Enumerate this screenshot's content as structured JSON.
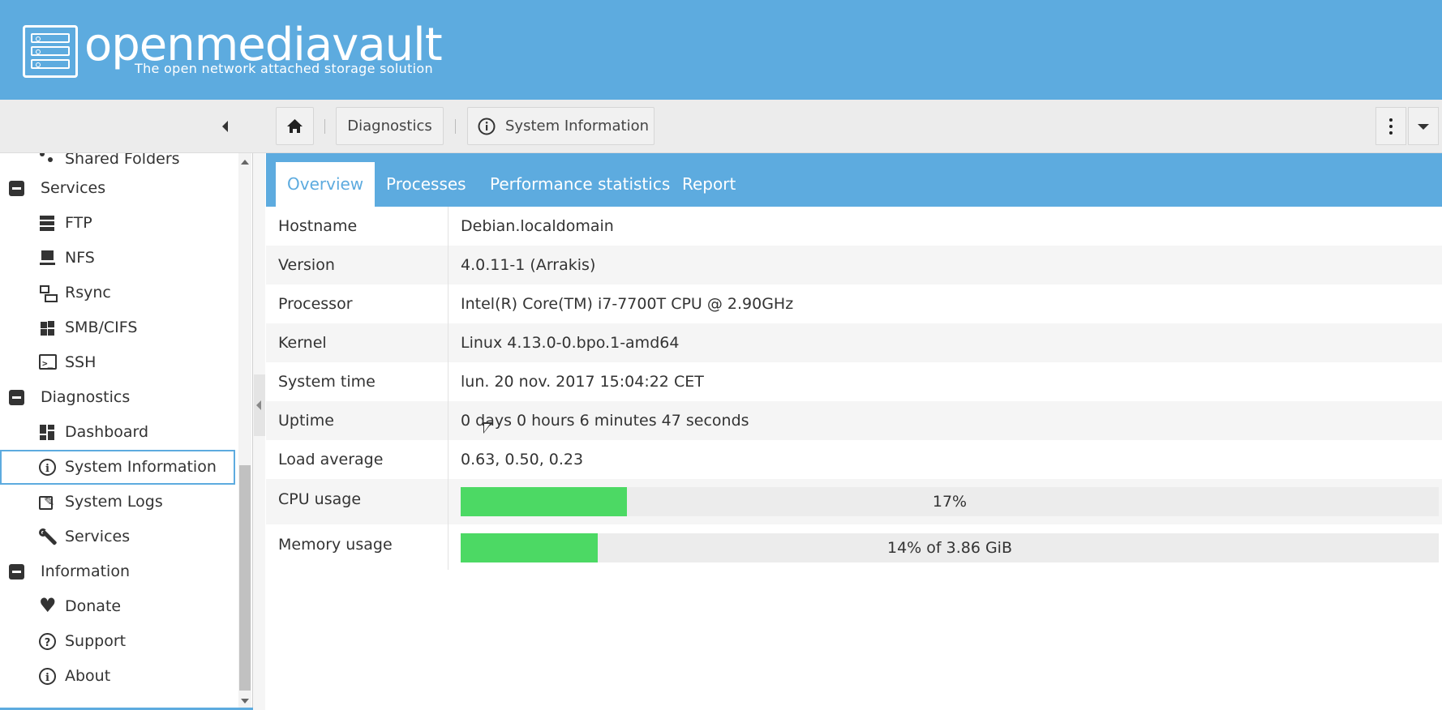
{
  "header": {
    "brand": "openmediavault",
    "tagline": "The open network attached storage solution"
  },
  "breadcrumb": {
    "items": [
      "Diagnostics",
      "System Information"
    ]
  },
  "sidebar": {
    "partial_item": "Shared Folders",
    "groups": [
      {
        "label": "Services",
        "items": [
          "FTP",
          "NFS",
          "Rsync",
          "SMB/CIFS",
          "SSH"
        ]
      },
      {
        "label": "Diagnostics",
        "items": [
          "Dashboard",
          "System Information",
          "System Logs",
          "Services"
        ]
      },
      {
        "label": "Information",
        "items": [
          "Donate",
          "Support",
          "About"
        ]
      }
    ],
    "active_item": "System Information"
  },
  "tabs": [
    {
      "label": "Overview",
      "active": true
    },
    {
      "label": "Processes",
      "active": false
    },
    {
      "label": "Performance statistics",
      "active": false
    },
    {
      "label": "Report",
      "active": false
    }
  ],
  "system_info": {
    "rows": [
      {
        "key": "Hostname",
        "value": "Debian.localdomain"
      },
      {
        "key": "Version",
        "value": "4.0.11-1 (Arrakis)"
      },
      {
        "key": "Processor",
        "value": "Intel(R) Core(TM) i7-7700T CPU @ 2.90GHz"
      },
      {
        "key": "Kernel",
        "value": "Linux 4.13.0-0.bpo.1-amd64"
      },
      {
        "key": "System time",
        "value": "lun. 20 nov. 2017 15:04:22 CET"
      },
      {
        "key": "Uptime",
        "value": "0 days 0 hours 6 minutes 47 seconds"
      },
      {
        "key": "Load average",
        "value": "0.63, 0.50, 0.23"
      }
    ],
    "cpu": {
      "key": "CPU usage",
      "text": "17%",
      "percent": 17
    },
    "memory": {
      "key": "Memory usage",
      "text": "14% of 3.86 GiB",
      "percent": 14
    }
  },
  "colors": {
    "brand_blue": "#5dabdf",
    "progress_green": "#4cd964"
  }
}
